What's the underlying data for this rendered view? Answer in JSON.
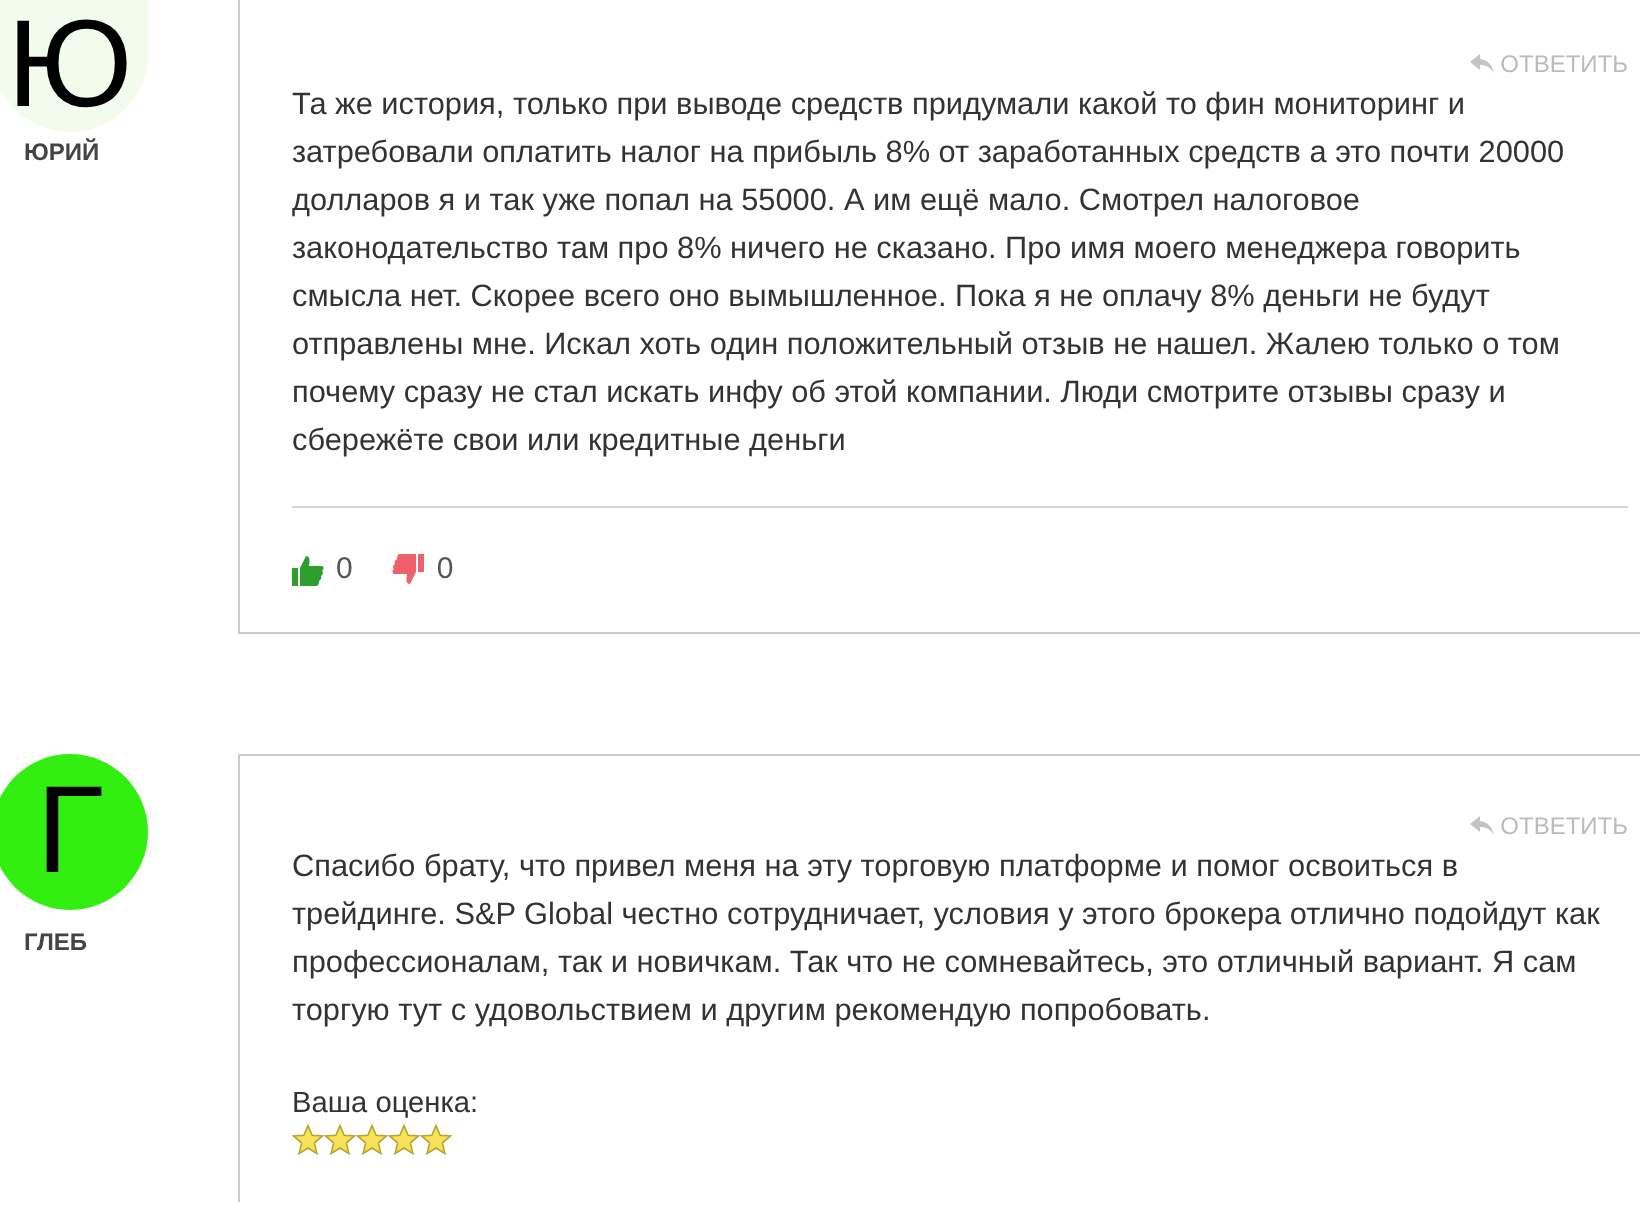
{
  "comments": [
    {
      "author": "ЮРИЙ",
      "initial": "Ю",
      "color": "#f3fbec",
      "reply": "ОТВЕТИТЬ",
      "text": "Та же история, только при выводе средств придумали какой то фин мониторинг и затребовали оплатить налог на прибыль 8% от заработанных средств а это почти 20000 долларов я и так уже попал на 55000. А им ещё мало. Смотрел налоговое законодательство там про 8% ничего не сказано. Про имя моего менеджера говорить смысла нет. Скорее всего оно вымышленное. Пока я не оплачу 8% деньги не будут отправлены мне. Искал хоть один положительный отзыв не нашел. Жалею только о том почему сразу не стал искать инфу об этой компании. Люди смотрите отзывы сразу и сбережёте свои или кредитные деньги",
      "likes": "0",
      "dislikes": "0"
    },
    {
      "author": "ГЛЕБ",
      "initial": "Г",
      "color": "#33ee11",
      "reply": "ОТВЕТИТЬ",
      "text": "Спасибо брату, что привел меня на эту торговую платформе и помог освоиться в трейдинге. S&P Global честно сотрудничает, условия у этого брокера отлично подойдут как профессионалам, так и новичкам. Так что не сомневайтесь, это отличный вариант. Я сам торгую тут с удовольствием и другим рекомендую попробовать.",
      "rating_label": "Ваша оценка:",
      "stars": 5
    }
  ]
}
